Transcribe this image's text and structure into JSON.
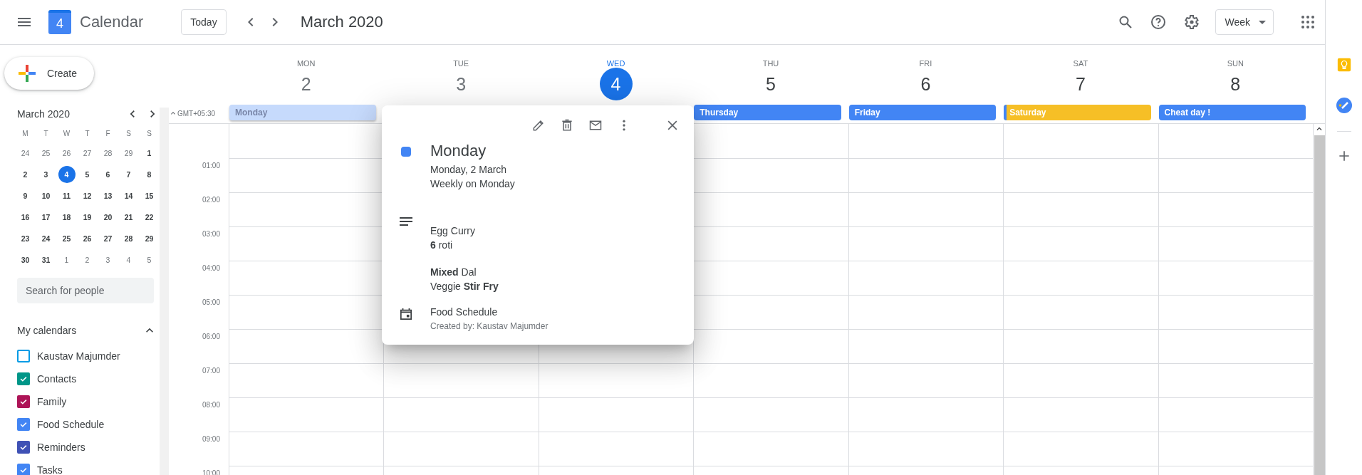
{
  "header": {
    "logo_day": "4",
    "title": "Calendar",
    "today_button": "Today",
    "period": "March 2020",
    "view": "Week"
  },
  "sidebar": {
    "create": "Create",
    "mini_calendar": {
      "title": "March 2020",
      "weekdays": [
        "M",
        "T",
        "W",
        "T",
        "F",
        "S",
        "S"
      ],
      "weeks": [
        [
          {
            "d": "24",
            "in_month": false,
            "selected": false
          },
          {
            "d": "25",
            "in_month": false,
            "selected": false
          },
          {
            "d": "26",
            "in_month": false,
            "selected": false
          },
          {
            "d": "27",
            "in_month": false,
            "selected": false
          },
          {
            "d": "28",
            "in_month": false,
            "selected": false
          },
          {
            "d": "29",
            "in_month": false,
            "selected": false
          },
          {
            "d": "1",
            "in_month": true,
            "selected": false
          }
        ],
        [
          {
            "d": "2",
            "in_month": true,
            "selected": false
          },
          {
            "d": "3",
            "in_month": true,
            "selected": false
          },
          {
            "d": "4",
            "in_month": true,
            "selected": true
          },
          {
            "d": "5",
            "in_month": true,
            "selected": false
          },
          {
            "d": "6",
            "in_month": true,
            "selected": false
          },
          {
            "d": "7",
            "in_month": true,
            "selected": false
          },
          {
            "d": "8",
            "in_month": true,
            "selected": false
          }
        ],
        [
          {
            "d": "9",
            "in_month": true,
            "selected": false
          },
          {
            "d": "10",
            "in_month": true,
            "selected": false
          },
          {
            "d": "11",
            "in_month": true,
            "selected": false
          },
          {
            "d": "12",
            "in_month": true,
            "selected": false
          },
          {
            "d": "13",
            "in_month": true,
            "selected": false
          },
          {
            "d": "14",
            "in_month": true,
            "selected": false
          },
          {
            "d": "15",
            "in_month": true,
            "selected": false
          }
        ],
        [
          {
            "d": "16",
            "in_month": true,
            "selected": false
          },
          {
            "d": "17",
            "in_month": true,
            "selected": false
          },
          {
            "d": "18",
            "in_month": true,
            "selected": false
          },
          {
            "d": "19",
            "in_month": true,
            "selected": false
          },
          {
            "d": "20",
            "in_month": true,
            "selected": false
          },
          {
            "d": "21",
            "in_month": true,
            "selected": false
          },
          {
            "d": "22",
            "in_month": true,
            "selected": false
          }
        ],
        [
          {
            "d": "23",
            "in_month": true,
            "selected": false
          },
          {
            "d": "24",
            "in_month": true,
            "selected": false
          },
          {
            "d": "25",
            "in_month": true,
            "selected": false
          },
          {
            "d": "26",
            "in_month": true,
            "selected": false
          },
          {
            "d": "27",
            "in_month": true,
            "selected": false
          },
          {
            "d": "28",
            "in_month": true,
            "selected": false
          },
          {
            "d": "29",
            "in_month": true,
            "selected": false
          }
        ],
        [
          {
            "d": "30",
            "in_month": true,
            "selected": false
          },
          {
            "d": "31",
            "in_month": true,
            "selected": false
          },
          {
            "d": "1",
            "in_month": false,
            "selected": false
          },
          {
            "d": "2",
            "in_month": false,
            "selected": false
          },
          {
            "d": "3",
            "in_month": false,
            "selected": false
          },
          {
            "d": "4",
            "in_month": false,
            "selected": false
          },
          {
            "d": "5",
            "in_month": false,
            "selected": false
          }
        ]
      ]
    },
    "search": {
      "placeholder": "Search for people"
    },
    "my_calendars": {
      "title": "My calendars",
      "expanded": true,
      "items": [
        {
          "name": "Kaustav Majumder",
          "checked": false,
          "color": "#039be5"
        },
        {
          "name": "Contacts",
          "checked": true,
          "color": "#009688"
        },
        {
          "name": "Family",
          "checked": true,
          "color": "#ad1457"
        },
        {
          "name": "Food Schedule",
          "checked": true,
          "color": "#4285f4"
        },
        {
          "name": "Reminders",
          "checked": true,
          "color": "#3f51b5"
        },
        {
          "name": "Tasks",
          "checked": true,
          "color": "#4285f4"
        }
      ]
    }
  },
  "week": {
    "timezone": "GMT+05:30",
    "days": [
      {
        "name": "MON",
        "number": "2",
        "today": false,
        "past": true,
        "event": {
          "title": "Monday",
          "color": "#c6dafc",
          "selected": true
        }
      },
      {
        "name": "TUE",
        "number": "3",
        "today": false,
        "past": true
      },
      {
        "name": "WED",
        "number": "4",
        "today": true,
        "past": false
      },
      {
        "name": "THU",
        "number": "5",
        "today": false,
        "past": false,
        "event": {
          "title": "Thursday",
          "color": "#4285f4",
          "selected": false
        }
      },
      {
        "name": "FRI",
        "number": "6",
        "today": false,
        "past": false,
        "event": {
          "title": "Friday",
          "color": "#4285f4",
          "selected": false
        }
      },
      {
        "name": "SAT",
        "number": "7",
        "today": false,
        "past": false,
        "event": {
          "title": "Saturday",
          "color": "#f6bf26",
          "selected": false,
          "stripe": {
            "color": "#4285f4"
          }
        }
      },
      {
        "name": "SUN",
        "number": "8",
        "today": false,
        "past": false,
        "event": {
          "title": "Cheat day !",
          "color": "#4285f4",
          "selected": false
        }
      }
    ],
    "hours": [
      "01:00",
      "02:00",
      "03:00",
      "04:00",
      "05:00",
      "06:00",
      "07:00",
      "08:00",
      "09:00",
      "10:00"
    ]
  },
  "popup": {
    "title": "Monday",
    "color": "#4285f4",
    "date": "Monday, 2 March",
    "recurrence": "Weekly on Monday",
    "description": [
      [
        "Egg Curry",
        "**6** roti"
      ],
      [
        "**Mixed** Dal",
        "Veggie **Stir Fry**"
      ]
    ],
    "calendar": "Food Schedule",
    "creator": "Created by: Kaustav Majumder"
  }
}
